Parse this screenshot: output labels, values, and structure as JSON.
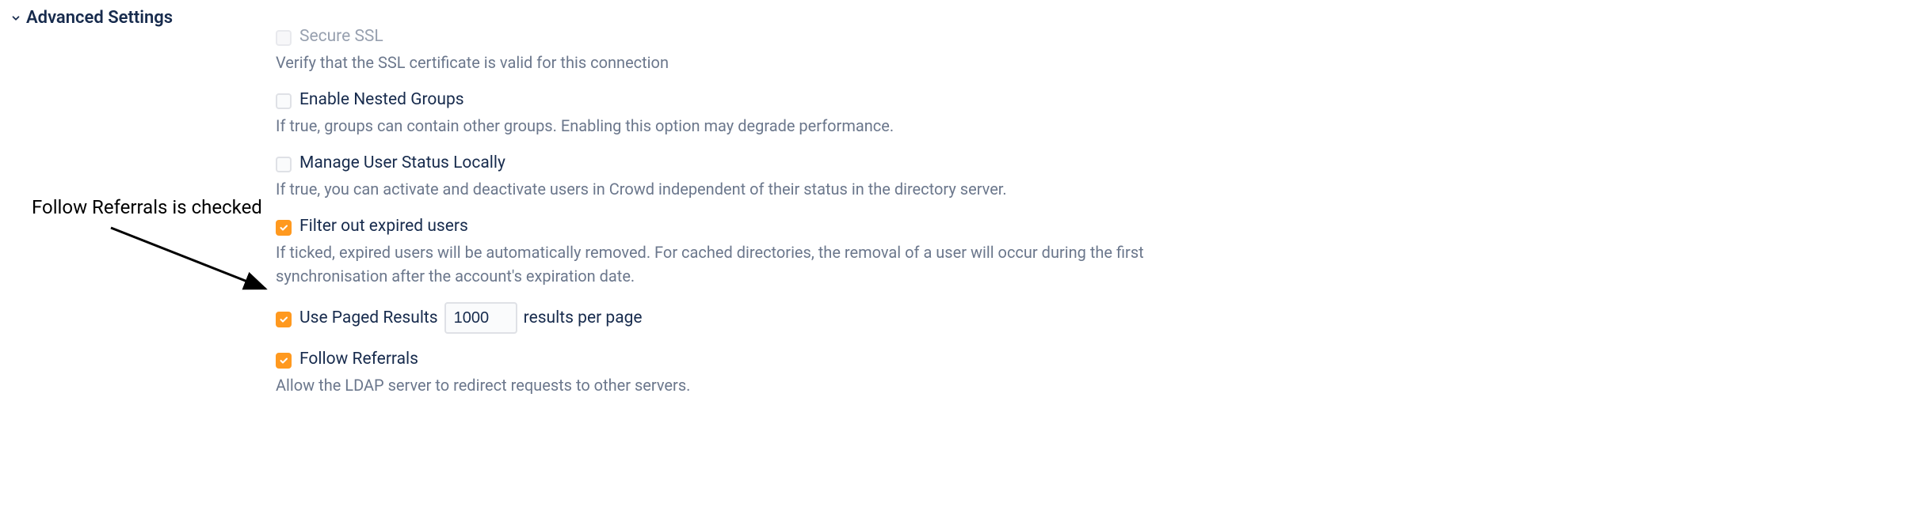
{
  "section": {
    "title": "Advanced Settings"
  },
  "annotation": {
    "text": "Follow Referrals is checked"
  },
  "settings": {
    "secure_ssl": {
      "label": "Secure SSL",
      "description": "Verify that the SSL certificate is valid for this connection"
    },
    "nested_groups": {
      "label": "Enable Nested Groups",
      "description": "If true, groups can contain other groups. Enabling this option may degrade performance."
    },
    "manage_user_status": {
      "label": "Manage User Status Locally",
      "description": "If true, you can activate and deactivate users in Crowd independent of their status in the directory server."
    },
    "filter_expired": {
      "label": "Filter out expired users",
      "description": "If ticked, expired users will be automatically removed. For cached directories, the removal of a user will occur during the first synchronisation after the account's expiration date."
    },
    "paged_results": {
      "label": "Use Paged Results",
      "value": "1000",
      "suffix": "results per page"
    },
    "follow_referrals": {
      "label": "Follow Referrals",
      "description": "Allow the LDAP server to redirect requests to other servers."
    }
  }
}
